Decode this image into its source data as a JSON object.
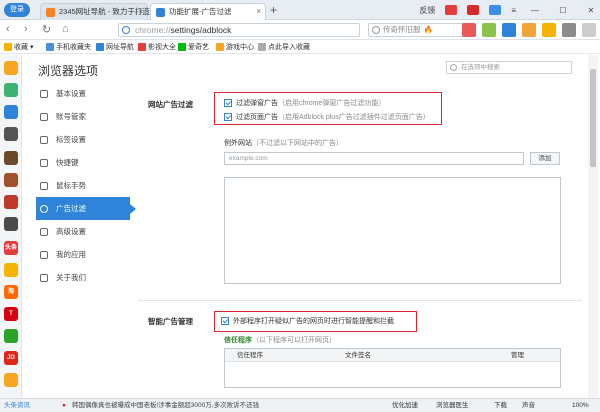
{
  "titlebar": {
    "login_label": "登录",
    "tabs": [
      {
        "title": "2345网址导航 - 致力于打造",
        "close": "×",
        "color": "#f58220"
      },
      {
        "title": "功能扩展-广告过滤",
        "close": "×",
        "color": "#2f83d8"
      }
    ],
    "new_tab": "+",
    "right_items": [
      "反馈",
      "≡"
    ],
    "win_min": "—",
    "win_max": "☐",
    "win_close": "✕",
    "new_badge": "new"
  },
  "addressbar": {
    "back": "‹",
    "forward": "›",
    "refresh": "↻",
    "home": "⌂",
    "url_proto": "chrome://",
    "url_path": "settings/adblock",
    "search_text": "传奇怀旧服",
    "flame": "🔥"
  },
  "bookmarks": [
    {
      "label": "收藏 ▾",
      "color": "#f5b400"
    },
    {
      "label": "手机收藏夹",
      "color": "#4a90d9"
    },
    {
      "label": "网址导航",
      "color": "#2f83d8"
    },
    {
      "label": "影视大全",
      "color": "#e43c3c"
    },
    {
      "label": "爱奇艺",
      "color": "#00be06"
    },
    {
      "label": "游戏中心",
      "color": "#f5a623"
    },
    {
      "label": "点此导入收藏",
      "color": "#aaaaaa"
    }
  ],
  "rail": [
    "",
    "",
    "",
    "",
    "",
    "",
    "",
    "",
    "头条",
    "",
    "淘",
    "T",
    "",
    "JD",
    "",
    ""
  ],
  "settings": {
    "title": "浏览器选项",
    "search_placeholder": "在选项中搜索",
    "nav": [
      {
        "label": "基本设置",
        "active": false
      },
      {
        "label": "账号管家",
        "active": false
      },
      {
        "label": "标签设置",
        "active": false
      },
      {
        "label": "快捷键",
        "active": false
      },
      {
        "label": "鼠标手势",
        "active": false
      },
      {
        "label": "广告过滤",
        "active": true
      },
      {
        "label": "高级设置",
        "active": false
      },
      {
        "label": "我的应用",
        "active": false
      },
      {
        "label": "关于我们",
        "active": false
      }
    ]
  },
  "adblock": {
    "section_label": "网站广告过滤",
    "option1": {
      "label": "过滤弹窗广告",
      "hint": "（启用chrome弹窗广告过滤功能）"
    },
    "option2": {
      "label": "过滤页面广告",
      "hint": "（启用Adblock plus广告过滤插件过滤页面广告）"
    },
    "exception_title": "例外网站",
    "exception_hint": "（不过滤以下网站中的广告）",
    "exception_placeholder": "example.com",
    "add_button": "添加"
  },
  "smart": {
    "section_label": "智能广告管理",
    "option_label": "外部程序打开疑似广告的网页时进行智能提醒和拦截",
    "trusted_title": "信任程序",
    "trusted_hint": "（以下程序可以打开网页）",
    "columns": [
      "信任程序",
      "文件签名",
      "管理"
    ]
  },
  "statusbar": {
    "news_label": "头条资讯",
    "ticker": "韩国偶像真也被曝成中国老板!涉事金额超3000万,多次败诉不还钱",
    "right_items": [
      "优化加速",
      "浏览器医生",
      "下载",
      "声音",
      "100%"
    ]
  },
  "colors": {
    "accent": "#2f83d8",
    "highlight_box": "#d9252e",
    "trusted_green": "#2a8a2a"
  }
}
